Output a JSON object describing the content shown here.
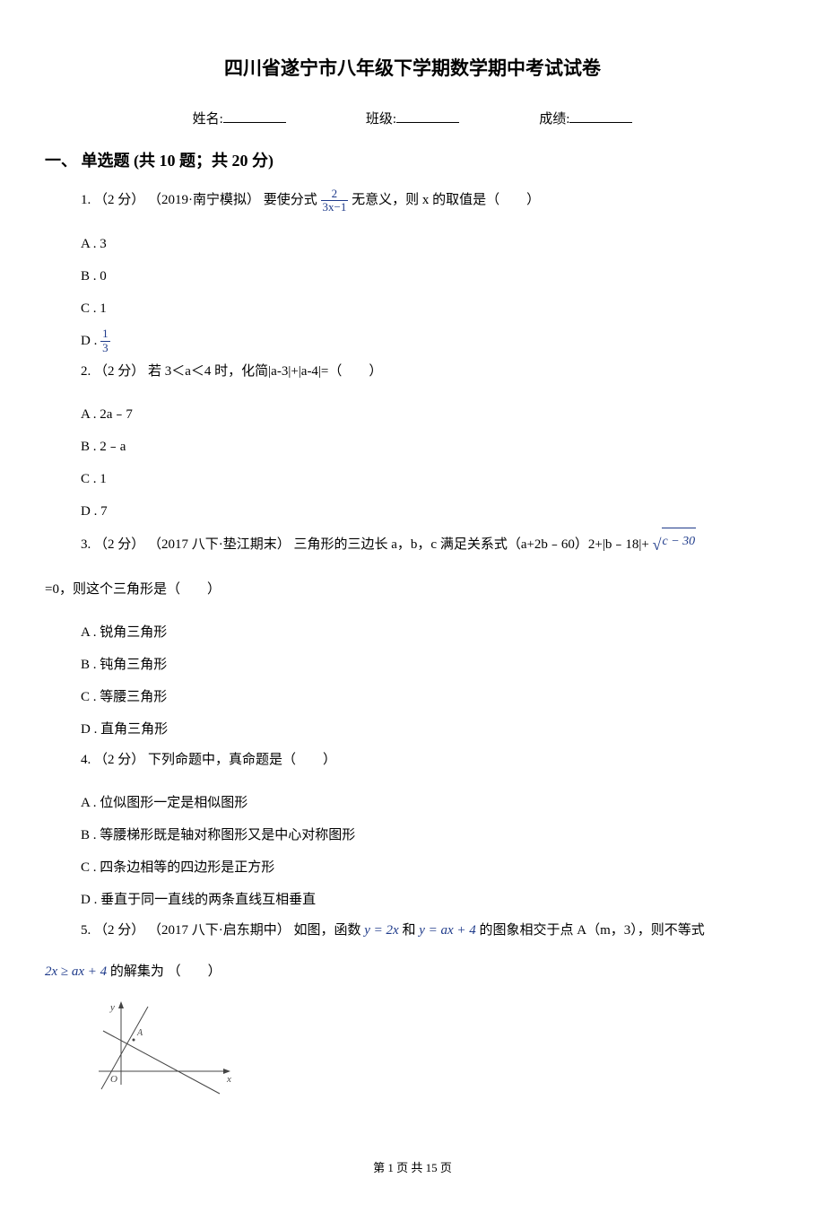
{
  "title": "四川省遂宁市八年级下学期数学期中考试试卷",
  "info": {
    "nameLabel": "姓名:",
    "classLabel": "班级:",
    "scoreLabel": "成绩:"
  },
  "section1": {
    "header": "一、 单选题 (共 10 题；共 20 分)"
  },
  "q1": {
    "stem_pre": "1.  （2 分） （2019·南宁模拟） 要使分式 ",
    "frac_num": "2",
    "frac_den": "3x−1",
    "stem_post": " 无意义，则 x 的取值是（　　）",
    "A": "A .  3",
    "B": "B .  0",
    "C": "C .  1",
    "D_pre": "D .  ",
    "D_num": "1",
    "D_den": "3"
  },
  "q2": {
    "stem": "2.  （2 分）  若 3＜a＜4 时，化简|a-3|+|a-4|=（　　）",
    "A": "A .  2a﹣7",
    "B": "B .  2﹣a",
    "C": "C .  1",
    "D": "D .  7"
  },
  "q3": {
    "stem_pre": "3.  （2 分） （2017 八下·垫江期末） 三角形的三边长 a，b，c 满足关系式（a+2b﹣60）2+|b﹣18|+ ",
    "sqrt_content": "c − 30",
    "stem_line2": "=0，则这个三角形是（　　）",
    "A": "A .  锐角三角形",
    "B": "B .  钝角三角形",
    "C": "C .  等腰三角形",
    "D": "D .  直角三角形"
  },
  "q4": {
    "stem": "4.  （2 分）  下列命题中，真命题是（　　）",
    "A": "A .  位似图形一定是相似图形",
    "B": "B .  等腰梯形既是轴对称图形又是中心对称图形",
    "C": "C .  四条边相等的四边形是正方形",
    "D": "D .  垂直于同一直线的两条直线互相垂直"
  },
  "q5": {
    "stem_pre": "5.  （2 分） （2017 八下·启东期中） 如图，函数 ",
    "expr1": "y = 2x",
    "stem_mid1": " 和 ",
    "expr2": "y = ax + 4",
    "stem_mid2": " 的图象相交于点 A（m，3），则不等式",
    "expr3": "2x ≥ ax + 4",
    "stem_end": " 的解集为 （　　）"
  },
  "footer": "第 1 页 共 15 页"
}
